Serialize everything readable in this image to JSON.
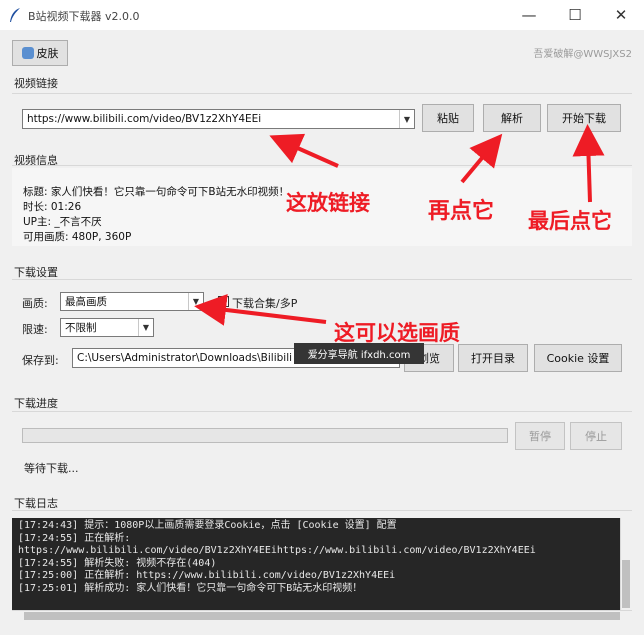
{
  "window": {
    "title": "B站视频下载器 v2.0.0",
    "controls": {
      "minimize": "—",
      "maximize": "☐",
      "close": "✕"
    }
  },
  "toolbar": {
    "theme_button": "皮肤",
    "credit": "吾爱破解@WWSJXS2"
  },
  "link_section": {
    "label": "视频链接",
    "url_value": "https://www.bilibili.com/video/BV1z2XhY4EEi",
    "paste_button": "粘贴",
    "parse_button": "解析",
    "download_button": "开始下载"
  },
  "info_section": {
    "label": "视频信息",
    "lines": [
      "标题: 家人们快看！它只靠一句命令可下B站无水印视频！",
      "时长: 01:26",
      "UP主: _不言不厌",
      "可用画质: 480P, 360P"
    ]
  },
  "settings_section": {
    "label": "下载设置",
    "quality_label": "画质:",
    "quality_value": "最高画质",
    "batch_label": "下载合集/多P",
    "speed_label": "限速:",
    "speed_value": "不限制",
    "save_label": "保存到:",
    "save_path": "C:\\Users\\Administrator\\Downloads\\Bilibili",
    "browse_button": "浏览",
    "open_dir_button": "打开目录",
    "cookie_button": "Cookie 设置"
  },
  "progress_section": {
    "label": "下载进度",
    "progress": 0,
    "pause_button": "暂停",
    "stop_button": "停止",
    "status": "等待下载..."
  },
  "log_section": {
    "label": "下载日志",
    "lines": [
      "[17:24:43] 提示：1080P以上画质需要登录Cookie，点击 [Cookie 设置] 配置",
      "[17:24:55] 正在解析:",
      "https://www.bilibili.com/video/BV1z2XhY4EEihttps://www.bilibili.com/video/BV1z2XhY4EEi",
      "[17:24:55] 解析失败: 视频不存在(404)",
      "[17:25:00] 正在解析: https://www.bilibili.com/video/BV1z2XhY4EEi",
      "[17:25:01] 解析成功: 家人们快看！它只靠一句命令可下B站无水印视频！"
    ]
  },
  "annotations": {
    "put_link": "这放链接",
    "click_again": "再点它",
    "click_last": "最后点它",
    "choose_quality": "这可以选画质"
  },
  "watermark": "爱分享导航 ifxdh.com",
  "colors": {
    "annotation": "#ee1c25",
    "log_bg": "#262626"
  }
}
